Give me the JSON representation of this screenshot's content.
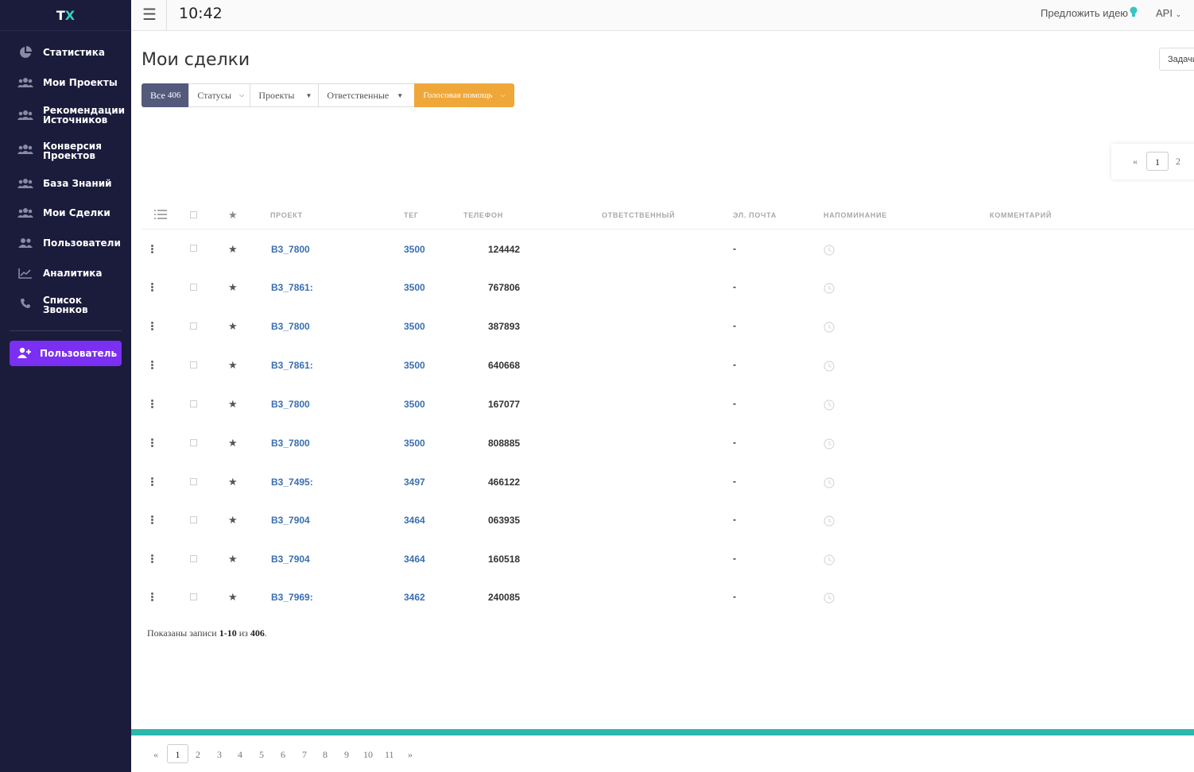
{
  "sidebar": {
    "logo_t": "T",
    "logo_x": "X",
    "items": [
      {
        "label": "Статистика",
        "icon": "pie-chart-icon"
      },
      {
        "label": "Мои Проекты",
        "icon": "users-icon"
      },
      {
        "label": "Рекомендации Источников",
        "icon": "users-icon"
      },
      {
        "label": "Конверсия Проектов",
        "icon": "users-icon"
      },
      {
        "label": "База Знаний",
        "icon": "users-icon"
      },
      {
        "label": "Мои Сделки",
        "icon": "users-icon"
      },
      {
        "label": "Пользователи",
        "icon": "users-icon"
      },
      {
        "label": "Аналитика",
        "icon": "line-chart-icon"
      },
      {
        "label": "Список Звонков",
        "icon": "phone-icon"
      }
    ],
    "user_button": "Пользователь"
  },
  "topbar": {
    "time": "10:42",
    "suggest": "Предложить идею",
    "api": "API"
  },
  "main": {
    "title": "Мои сделки",
    "tasks_button": "Задачи",
    "filters": {
      "all_label": "Все",
      "all_count": "406",
      "statuses": "Статусы",
      "projects": "Проекты",
      "responsible": "Ответственные",
      "voice": "Голосовая помощь"
    },
    "top_pager": {
      "prev": "«",
      "pages": [
        "1",
        "2"
      ],
      "active": "1"
    },
    "table": {
      "columns": [
        "ПРОЕКТ",
        "ТЕГ",
        "ТЕЛЕФОН",
        "ОТВЕТСТВЕННЫЙ",
        "ЭЛ. ПОЧТА",
        "НАПОМИНАНИЕ",
        "КОММЕНТАРИЙ"
      ],
      "rows": [
        {
          "project": "B3_7800",
          "tag": "3500",
          "phone": "124442",
          "email": "-"
        },
        {
          "project": "B3_7861:",
          "tag": "3500",
          "phone": "767806",
          "email": "-"
        },
        {
          "project": "B3_7800",
          "tag": "3500",
          "phone": "387893",
          "email": "-"
        },
        {
          "project": "B3_7861:",
          "tag": "3500",
          "phone": "640668",
          "email": "-"
        },
        {
          "project": "B3_7800",
          "tag": "3500",
          "phone": "167077",
          "email": "-"
        },
        {
          "project": "B3_7800",
          "tag": "3500",
          "phone": "808885",
          "email": "-"
        },
        {
          "project": "B3_7495:",
          "tag": "3497",
          "phone": "466122",
          "email": "-"
        },
        {
          "project": "B3_7904",
          "tag": "3464",
          "phone": "063935",
          "email": "-"
        },
        {
          "project": "B3_7904",
          "tag": "3464",
          "phone": "160518",
          "email": "-"
        },
        {
          "project": "B3_7969:",
          "tag": "3462",
          "phone": "240085",
          "email": "-"
        }
      ]
    },
    "records": {
      "prefix": "Показаны записи",
      "range": "1-10",
      "mid": "из",
      "total": "406",
      "suffix": "."
    },
    "bottom_pager": {
      "prev": "«",
      "pages": [
        "1",
        "2",
        "3",
        "4",
        "5",
        "6",
        "7",
        "8",
        "9",
        "10",
        "11"
      ],
      "next": "»",
      "active": "1"
    }
  },
  "colors": {
    "sidebar_bg": "#1b1b3c",
    "accent_purple": "#7a2ff2",
    "accent_orange": "#efa73a",
    "accent_teal": "#2bb8ae",
    "link_blue": "#3a6fb0"
  }
}
